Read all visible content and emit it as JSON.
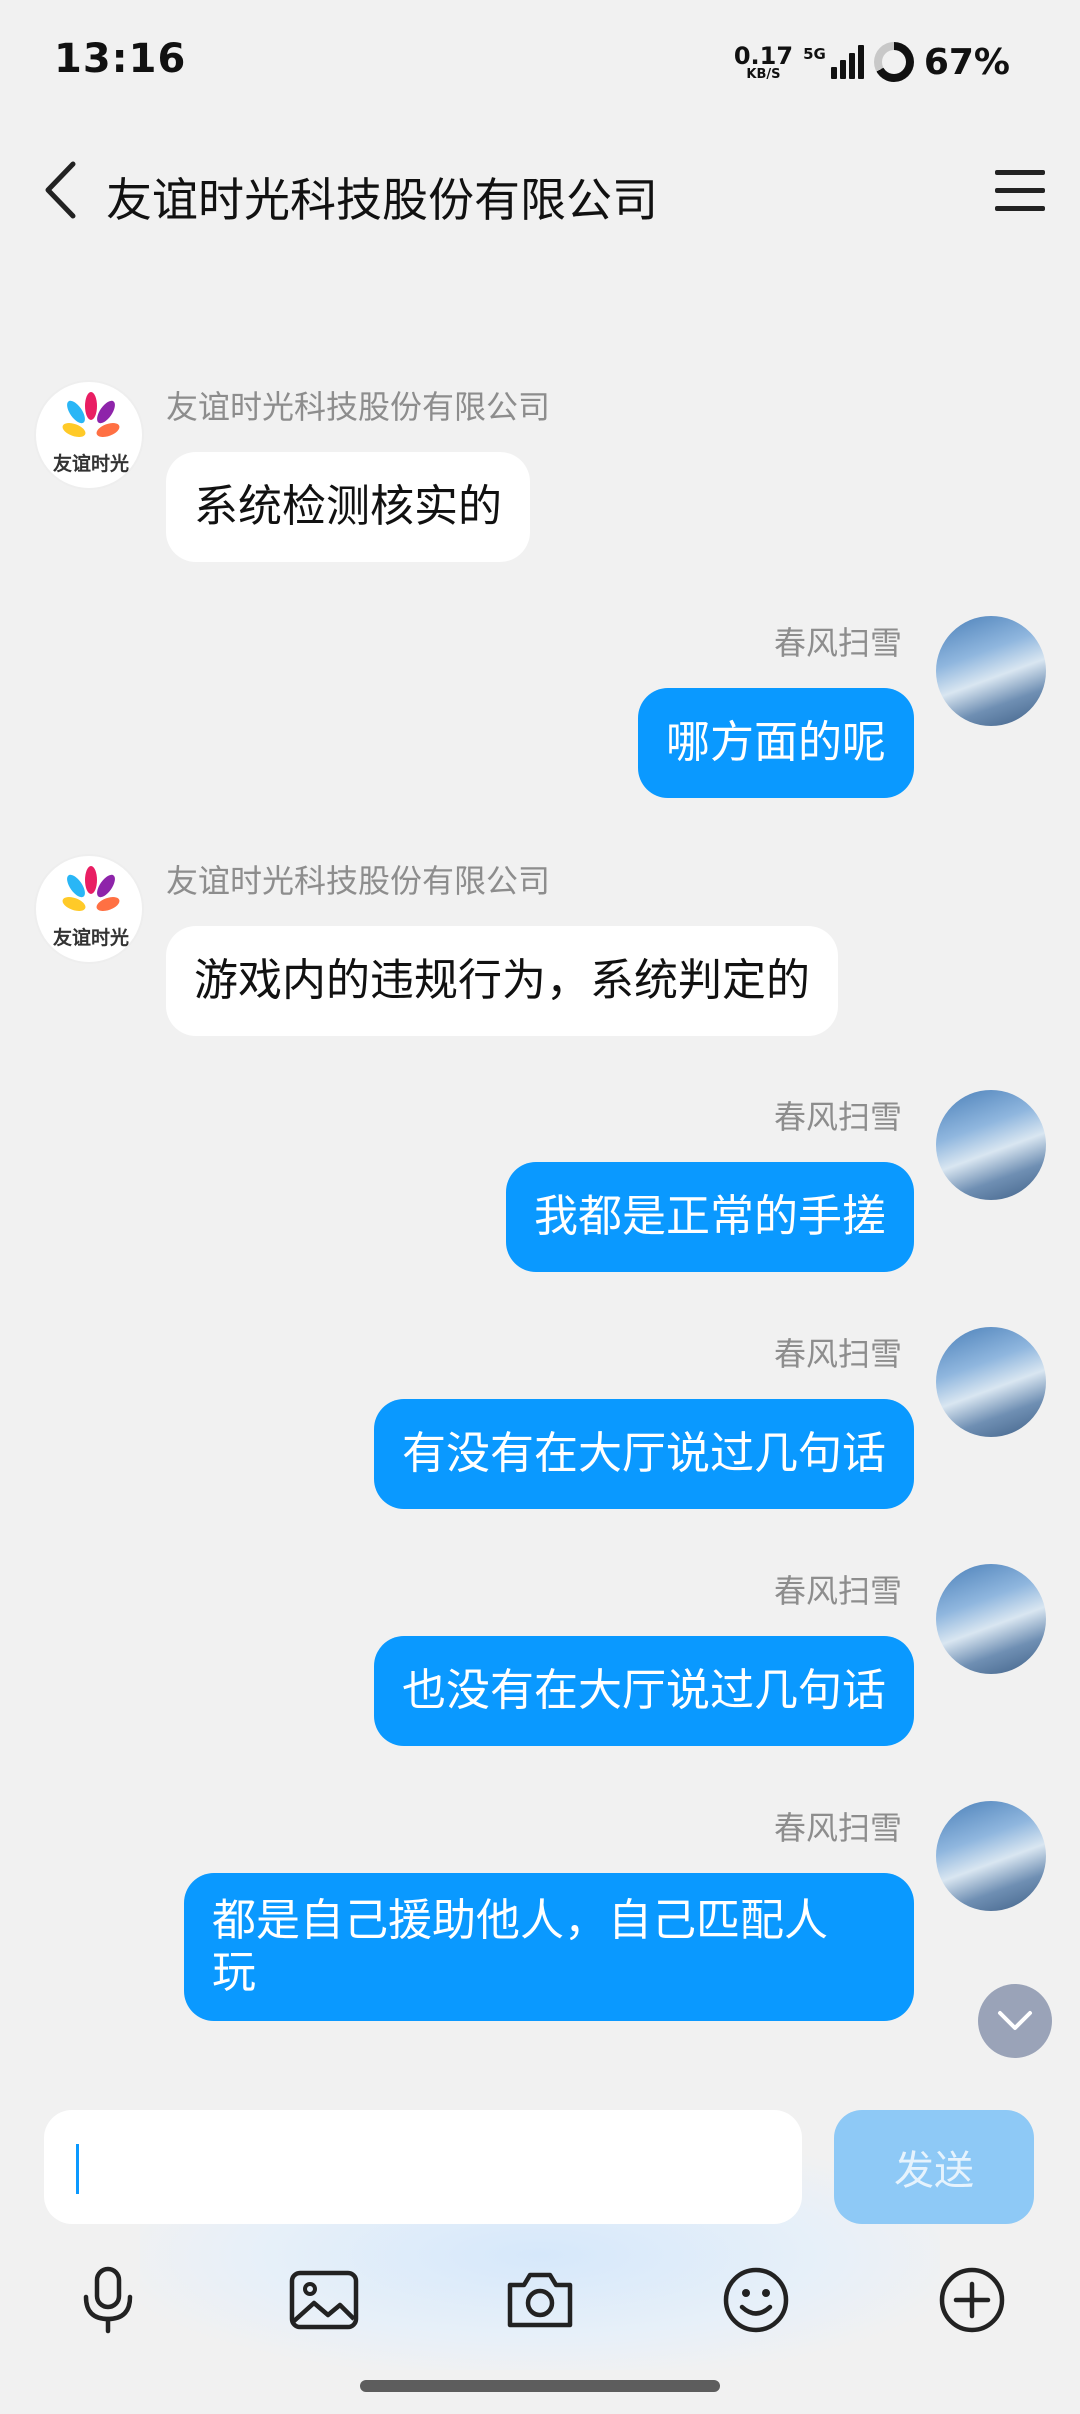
{
  "status_bar": {
    "time": "13:16",
    "net_speed_value": "0.17",
    "net_speed_unit": "KB/S",
    "network_type": "5G",
    "battery_level": 0.67,
    "battery_percent": "67%"
  },
  "header": {
    "title": "友谊时光科技股份有限公司"
  },
  "messages": [
    {
      "side": "left",
      "sender": "友谊时光科技股份有限公司",
      "text": "系统检测核实的"
    },
    {
      "side": "right",
      "sender": "春风扫雪",
      "text": "哪方面的呢"
    },
    {
      "side": "left",
      "sender": "友谊时光科技股份有限公司",
      "text": "游戏内的违规行为，系统判定的"
    },
    {
      "side": "right",
      "sender": "春风扫雪",
      "text": "我都是正常的手搓"
    },
    {
      "side": "right",
      "sender": "春风扫雪",
      "text": "有没有在大厅说过几句话"
    },
    {
      "side": "right",
      "sender": "春风扫雪",
      "text": "也没有在大厅说过几句话"
    },
    {
      "side": "right",
      "sender": "春风扫雪",
      "text_line1": "都是自己援助他人，自己匹配人",
      "text_line2": "玩"
    }
  ],
  "input": {
    "value": "",
    "send_label": "发送"
  },
  "toolbar": {
    "icons": [
      "microphone-icon",
      "image-icon",
      "camera-icon",
      "emoji-icon",
      "plus-icon"
    ]
  },
  "colors": {
    "bubble_right": "#0a99ff",
    "bubble_left": "#ffffff",
    "background": "#f1f1f1",
    "send_button": "#8ec9f6"
  }
}
